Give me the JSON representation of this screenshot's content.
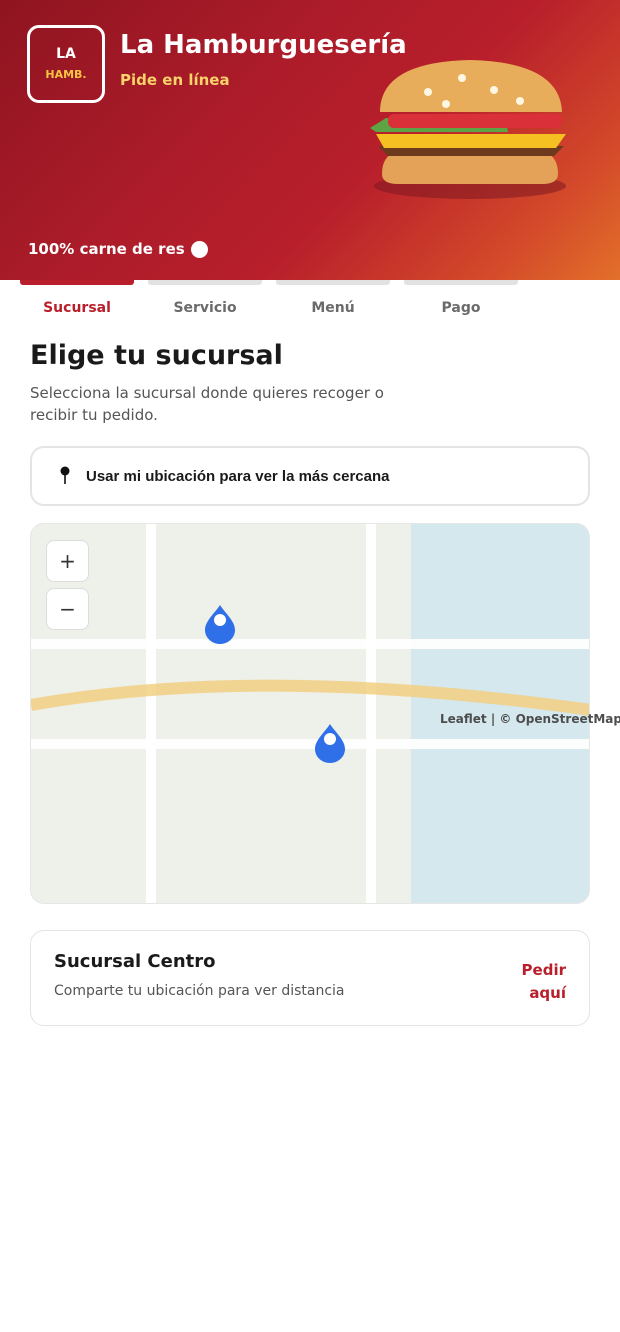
{
  "brand": {
    "logo_line1": "LA",
    "logo_line2": "HAMB.",
    "title": "La Hamburguesería",
    "subtitle": "Pide en línea",
    "tagline": "100% carne de res"
  },
  "steps": [
    {
      "label": "Sucursal",
      "active": true
    },
    {
      "label": "Servicio",
      "active": false
    },
    {
      "label": "Menú",
      "active": false
    },
    {
      "label": "Pago",
      "active": false
    }
  ],
  "main": {
    "title": "Elige tu sucursal",
    "description": "Selecciona la sucursal donde quieres recoger o recibir tu pedido.",
    "location_button": "Usar mi ubicación para ver la más cercana"
  },
  "map": {
    "zoom_in": "+",
    "zoom_out": "−",
    "attribution": "Leaflet | © OpenStreetMap",
    "marker_count": 2
  },
  "branch": {
    "name": "Sucursal Centro",
    "distance": "Comparte tu ubicación para ver distancia",
    "action": "Pedir aquí"
  },
  "colors": {
    "brand_red": "#b81f2b",
    "accent_yellow": "#f5c543",
    "marker_blue": "#2f6fe8"
  }
}
